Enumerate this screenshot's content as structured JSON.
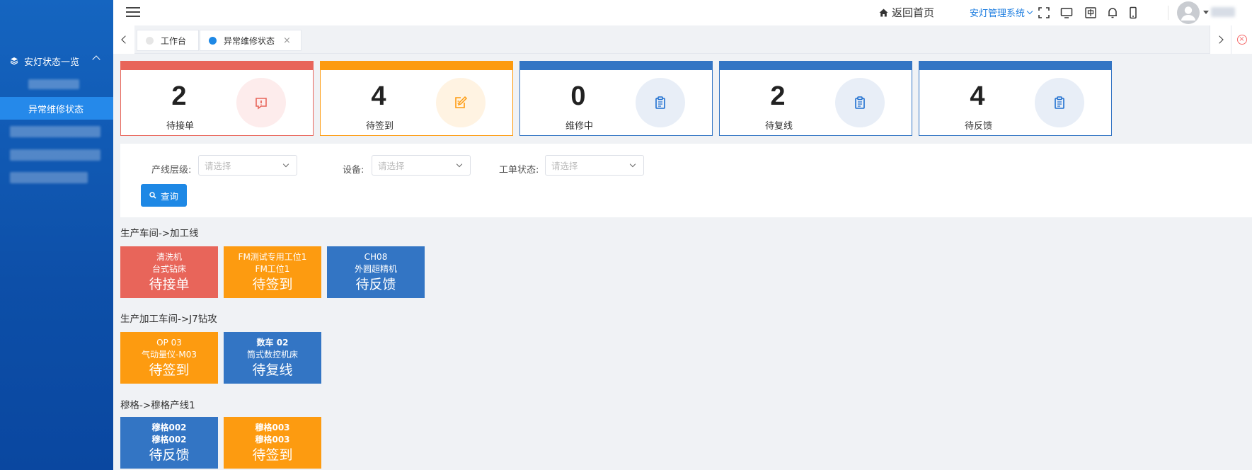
{
  "colors": {
    "sidebar": "#1565c0",
    "sidebar_active": "#2589ea",
    "accent": "#1e88e5",
    "red": "#e8655a",
    "orange": "#fd9b10",
    "blue": "#3375c4",
    "red_circle": "#fdecec",
    "orange_circle": "#fff3e2",
    "blue_circle": "#e8eef7"
  },
  "sidebar": {
    "group_label": "安灯状态一览",
    "active_item": "异常维修状态"
  },
  "header": {
    "home_label": "返回首页",
    "system_label": "安灯管理系统",
    "icons": [
      "fullscreen-icon",
      "monitor-icon",
      "language-icon",
      "bell-icon",
      "mobile-icon"
    ]
  },
  "tabs": [
    {
      "label": "工作台",
      "active": false
    },
    {
      "label": "异常维修状态",
      "active": true,
      "close": "×"
    }
  ],
  "stats": [
    {
      "value": "2",
      "label": "待接单",
      "color": "#e8655a",
      "icon": "alert-icon"
    },
    {
      "value": "4",
      "label": "待签到",
      "color": "#fd9b10",
      "icon": "edit-icon"
    },
    {
      "value": "0",
      "label": "维修中",
      "color": "#3375c4",
      "icon": "clipboard-icon"
    },
    {
      "value": "2",
      "label": "待复线",
      "color": "#3375c4",
      "icon": "clipboard-icon"
    },
    {
      "value": "4",
      "label": "待反馈",
      "color": "#3375c4",
      "icon": "clipboard-icon"
    }
  ],
  "filter": {
    "line_label": "产线层级:",
    "device_label": "设备:",
    "order_label": "工单状态:",
    "placeholder": "请选择",
    "query_label": "查询"
  },
  "groups": [
    {
      "title": "生产车间->加工线",
      "tiles": [
        {
          "l1": "清洗机",
          "l2": "台式钻床",
          "status": "待接单",
          "color": "#e8655a",
          "bold": false
        },
        {
          "l1": "FM测试专用工位1",
          "l2": "FM工位1",
          "status": "待签到",
          "color": "#fd9b10",
          "bold": false
        },
        {
          "l1": "CH08",
          "l2": "外圆超精机",
          "status": "待反馈",
          "color": "#3375c4",
          "bold": false
        }
      ]
    },
    {
      "title": "生产加工车间->J7钻攻",
      "tiles": [
        {
          "l1": "OP 03",
          "l2": "气动量仪-M03",
          "status": "待签到",
          "color": "#fd9b10",
          "bold": false
        },
        {
          "l1": "数车 02",
          "l2": "筒式数控机床",
          "status": "待复线",
          "color": "#3375c4",
          "bold": true
        }
      ]
    },
    {
      "title": "穆格->穆格产线1",
      "tiles": [
        {
          "l1": "穆格002",
          "l2": "穆格002",
          "status": "待反馈",
          "color": "#3375c4",
          "bold": true
        },
        {
          "l1": "穆格003",
          "l2": "穆格003",
          "status": "待签到",
          "color": "#fd9b10",
          "bold": true
        }
      ]
    }
  ]
}
